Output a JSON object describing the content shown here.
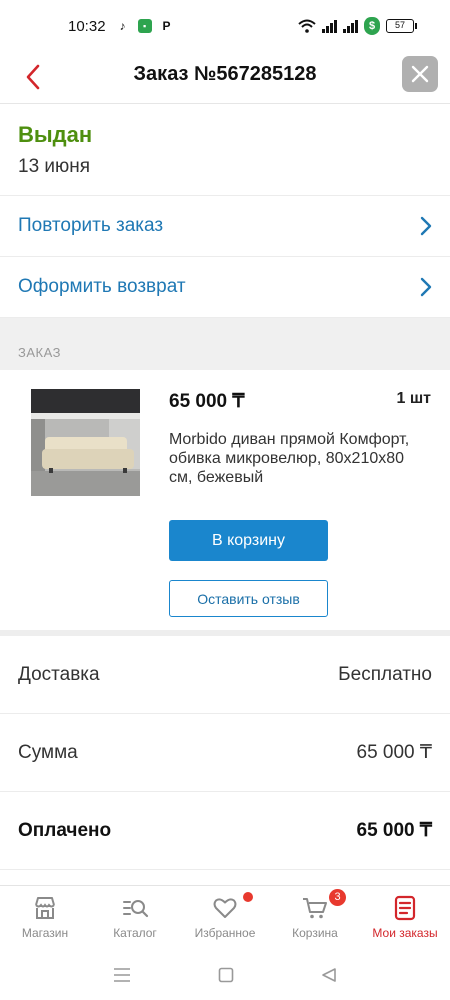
{
  "status_bar": {
    "time": "10:32",
    "battery": "57"
  },
  "header": {
    "title": "Заказ №567285128"
  },
  "order": {
    "status": "Выдан",
    "date": "13 июня"
  },
  "actions": [
    {
      "label": "Повторить заказ"
    },
    {
      "label": "Оформить возврат"
    }
  ],
  "section_title": "ЗАКАЗ",
  "product": {
    "price": "65 000 ₸",
    "quantity": "1 шт",
    "name": "Morbido диван прямой Комфорт, обивка микровелюр, 80х210х80 см, бежевый",
    "cart_button": "В корзину",
    "review_button": "Оставить отзыв"
  },
  "summary": [
    {
      "label": "Доставка",
      "value": "Бесплатно"
    },
    {
      "label": "Сумма",
      "value": "65 000 ₸"
    },
    {
      "label": "Оплачено",
      "value": "65 000 ₸"
    }
  ],
  "bottom_nav": [
    {
      "label": "Магазин",
      "icon": "store-icon"
    },
    {
      "label": "Каталог",
      "icon": "catalog-search-icon"
    },
    {
      "label": "Избранное",
      "icon": "heart-icon"
    },
    {
      "label": "Корзина",
      "icon": "cart-icon",
      "badge": "3"
    },
    {
      "label": "Мои заказы",
      "icon": "orders-icon"
    }
  ],
  "colors": {
    "accent_blue": "#1a86cd",
    "status_green": "#4e8f0f",
    "active_red": "#d3262b"
  }
}
